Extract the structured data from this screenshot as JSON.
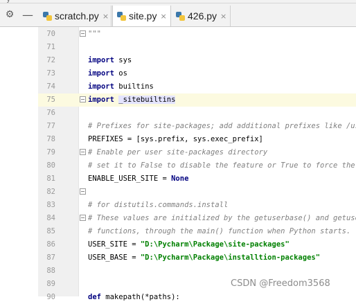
{
  "top_partial_text": "y",
  "toolbar": {
    "settings_icon": "gear-icon",
    "hide_icon": "minus-icon"
  },
  "tabs": [
    {
      "label": "scratch.py",
      "active": false
    },
    {
      "label": "site.py",
      "active": true
    },
    {
      "label": "426.py",
      "active": false
    }
  ],
  "tab_close_glyph": "×",
  "caret_line": 75,
  "watermark": "CSDN @Freedom3568",
  "lines": [
    {
      "n": "70",
      "t": "\"\"\""
    },
    {
      "n": "71",
      "t": ""
    },
    {
      "n": "72",
      "t": "import sys"
    },
    {
      "n": "73",
      "t": "import os"
    },
    {
      "n": "74",
      "t": "import builtins"
    },
    {
      "n": "75",
      "t": "import _sitebuiltins"
    },
    {
      "n": "76",
      "t": ""
    },
    {
      "n": "77",
      "t": "# Prefixes for site-packages; add additional prefixes like /usr/l"
    },
    {
      "n": "78",
      "t": "PREFIXES = [sys.prefix, sys.exec_prefix]"
    },
    {
      "n": "79",
      "t": "# Enable per user site-packages directory"
    },
    {
      "n": "80",
      "t": "# set it to False to disable the feature or True to force the fea"
    },
    {
      "n": "81",
      "t": "ENABLE_USER_SITE = None"
    },
    {
      "n": "82",
      "t": ""
    },
    {
      "n": "83",
      "t": "# for distutils.commands.install"
    },
    {
      "n": "84",
      "t": "# These values are initialized by the getuserbase() and getusersi"
    },
    {
      "n": "85",
      "t": "# functions, through the main() function when Python starts."
    },
    {
      "n": "86",
      "t": "USER_SITE = \"D:\\Pycharm\\Package\\site-packages\""
    },
    {
      "n": "87",
      "t": "USER_BASE = \"D:\\Pycharm\\Package\\installtion-packages\""
    },
    {
      "n": "88",
      "t": ""
    },
    {
      "n": "89",
      "t": ""
    },
    {
      "n": "90",
      "t": "def makepath(*paths):"
    }
  ]
}
